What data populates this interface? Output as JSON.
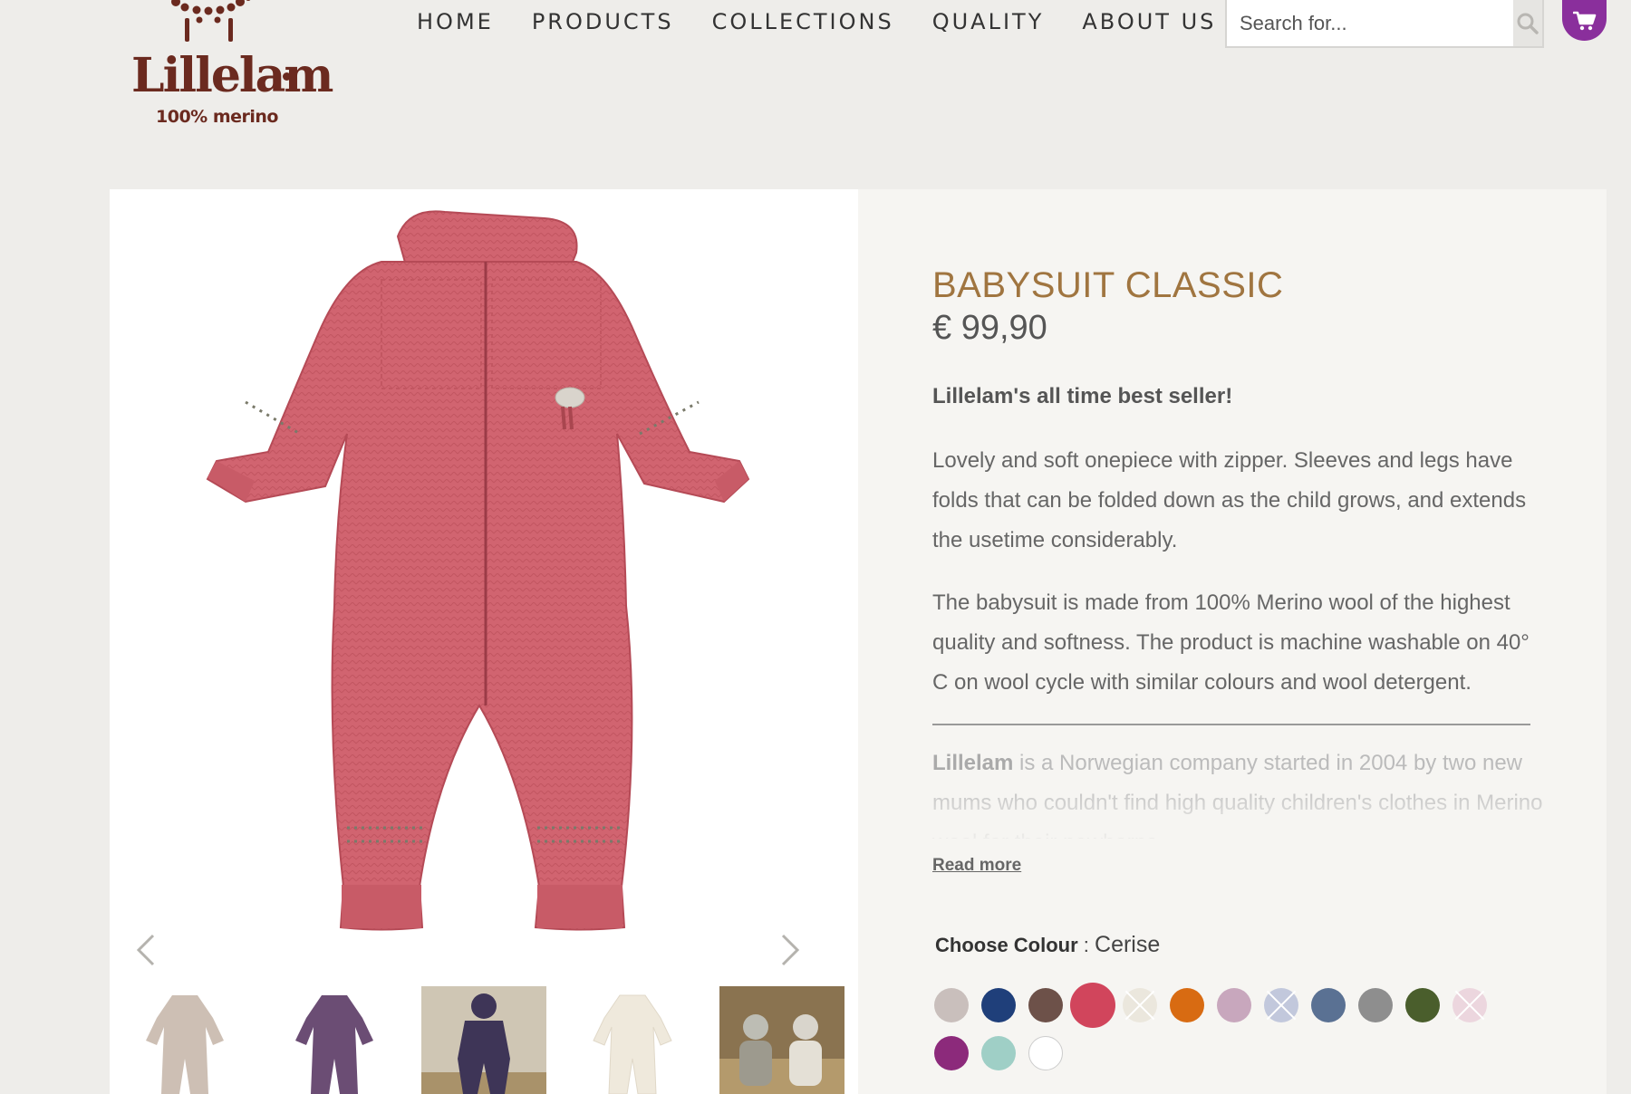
{
  "brand": {
    "name": "Lillelam",
    "tagline": "100% merino",
    "colors": {
      "logo": "#6b2a1f",
      "accent": "#8a2f9c",
      "title": "#a07540"
    }
  },
  "nav": {
    "items": [
      "HOME",
      "PRODUCTS",
      "COLLECTIONS",
      "QUALITY",
      "ABOUT US"
    ]
  },
  "search": {
    "placeholder": "Search for...",
    "icon": "search-icon"
  },
  "cart": {
    "icon": "cart-icon"
  },
  "product": {
    "title": "BABYSUIT CLASSIC",
    "price": "€ 99,90",
    "lead": "Lillelam's all time best seller!",
    "description_1": "Lovely and soft onepiece with zipper. Sleeves and legs have folds that can be folded down as the child grows, and extends the usetime considerably.",
    "description_2": "The babysuit is made from 100% Merino wool of the highest quality and softness. The product is machine washable on 40° C on wool cycle with similar colours and wool detergent.",
    "about_brand": "Lillelam",
    "about_text": " is a Norwegian company started in 2004 by two new mums who couldn't find high quality children's clothes in Merino wool for their newborns.",
    "read_more": "Read more",
    "colour_label": "Choose Colour",
    "colour_separator": " : ",
    "selected_colour": "Cerise",
    "main_image_colour": "#d16470",
    "gallery_arrows": [
      "chevron-left-icon",
      "chevron-right-icon"
    ],
    "swatches": [
      {
        "color": "#c9bfbc",
        "available": true
      },
      {
        "color": "#1f3f7a",
        "available": true
      },
      {
        "color": "#6d5149",
        "available": true
      },
      {
        "color": "#d1455c",
        "available": true,
        "selected": true
      },
      {
        "color": "#ebe7dd",
        "available": false
      },
      {
        "color": "#d86b12",
        "available": true
      },
      {
        "color": "#c8a7bd",
        "available": true
      },
      {
        "color": "#c2c8dc",
        "available": false
      },
      {
        "color": "#5a7193",
        "available": true
      },
      {
        "color": "#8e8e8e",
        "available": true
      },
      {
        "color": "#4a5e2c",
        "available": true
      },
      {
        "color": "#ecd6de",
        "available": false
      },
      {
        "color": "#8c2a7b",
        "available": true
      },
      {
        "color": "#9fcfc6",
        "available": true
      },
      {
        "color": "#ffffff",
        "available": true
      }
    ],
    "thumbnails": [
      {
        "color": "#cdbfb4"
      },
      {
        "color": "#6b4d74"
      },
      {
        "color": "#3e3557"
      },
      {
        "color": "#efe9dc"
      },
      {
        "color": "#8a7350"
      }
    ]
  }
}
